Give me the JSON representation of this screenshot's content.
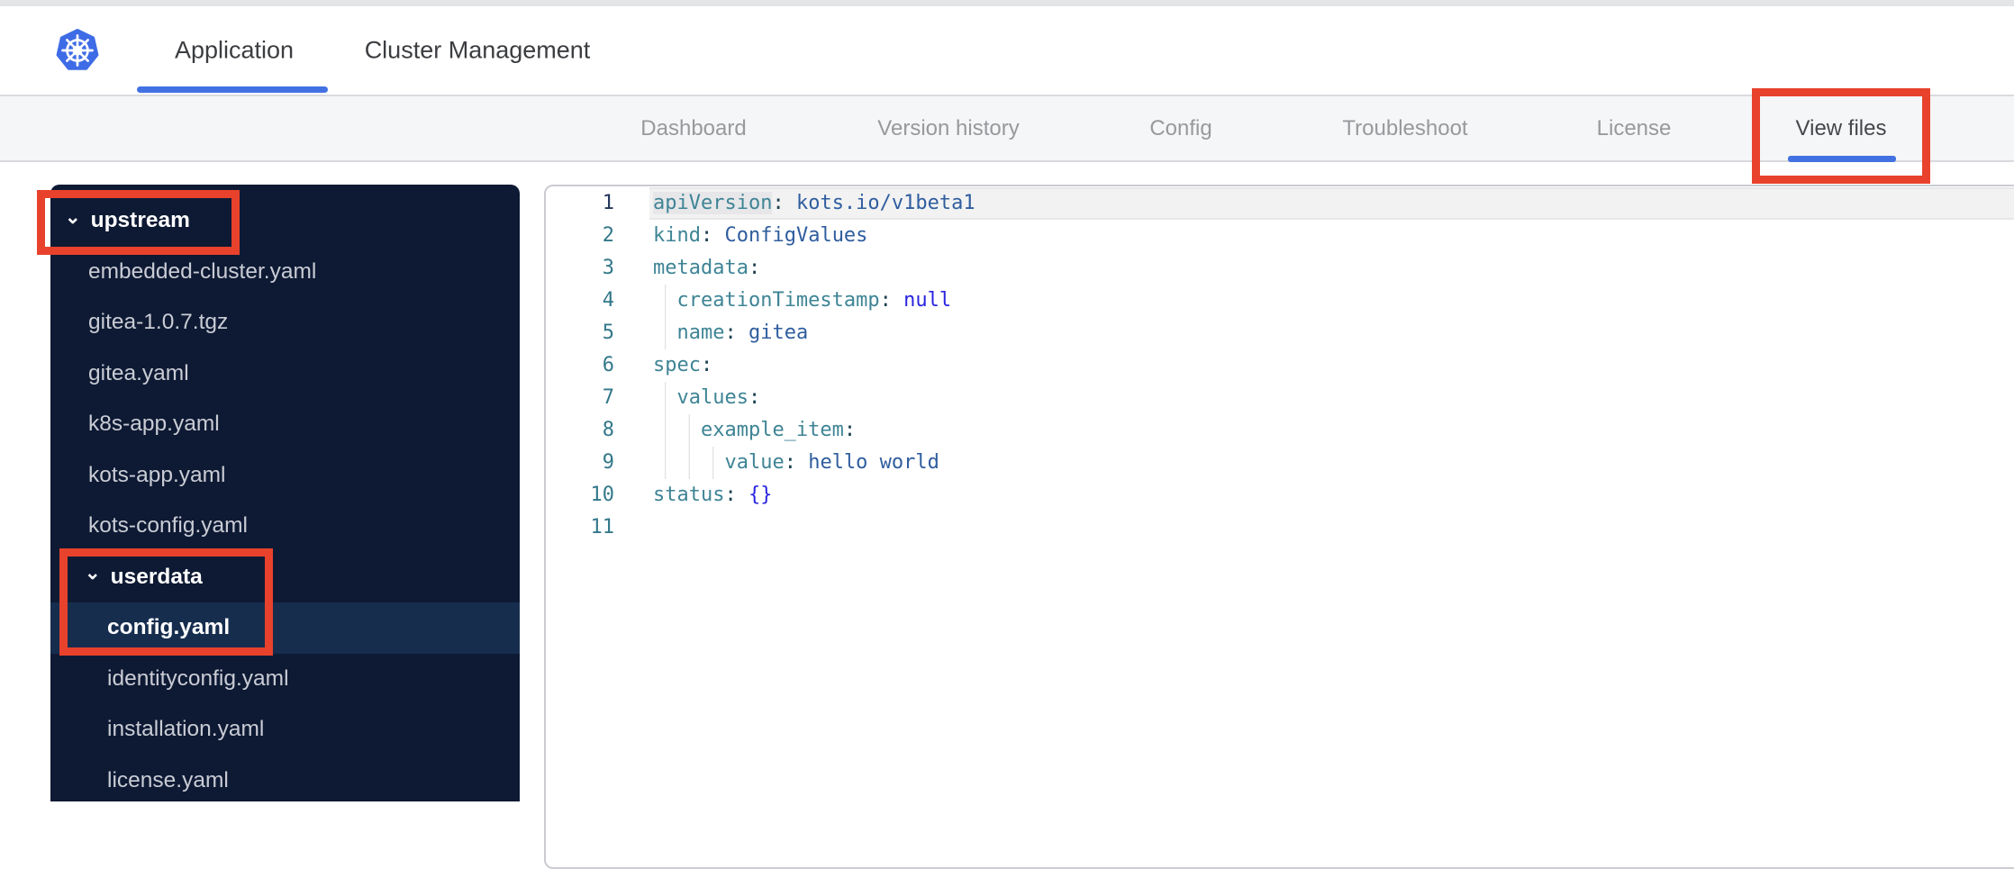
{
  "colors": {
    "accent": "#4271e2",
    "logo-blue": "#3e6ce6",
    "annotation": "#e8422c",
    "sidebar-bg": "#0e1a34",
    "sidebar-selected": "#162d4e",
    "sidebar-file": "#c9ccd4",
    "key": "#3e8495",
    "colon": "#1d4050",
    "value": "#2f5d9e",
    "keyword": "#2a24e0",
    "linenum": "#33788a",
    "nav-inactive": "#97999c",
    "nav-active": "#44474b",
    "header-text": "#3b3d40"
  },
  "header": {
    "logo": "kubernetes-logo",
    "tabs": [
      {
        "label": "Application",
        "active": true
      },
      {
        "label": "Cluster Management",
        "active": false
      }
    ]
  },
  "nav": {
    "items": [
      {
        "label": "Dashboard",
        "active": false
      },
      {
        "label": "Version history",
        "active": false
      },
      {
        "label": "Config",
        "active": false
      },
      {
        "label": "Troubleshoot",
        "active": false
      },
      {
        "label": "License",
        "active": false
      },
      {
        "label": "View files",
        "active": true
      }
    ]
  },
  "file_tree": {
    "chevron": "⌄",
    "items": [
      {
        "label": "upstream",
        "type": "folder",
        "level": 0,
        "expanded": true,
        "annotated": true
      },
      {
        "label": "embedded-cluster.yaml",
        "type": "file",
        "level": 1
      },
      {
        "label": "gitea-1.0.7.tgz",
        "type": "file",
        "level": 1
      },
      {
        "label": "gitea.yaml",
        "type": "file",
        "level": 1
      },
      {
        "label": "k8s-app.yaml",
        "type": "file",
        "level": 1
      },
      {
        "label": "kots-app.yaml",
        "type": "file",
        "level": 1
      },
      {
        "label": "kots-config.yaml",
        "type": "file",
        "level": 1
      },
      {
        "label": "userdata",
        "type": "folder",
        "level": 1,
        "expanded": true,
        "annotated": true
      },
      {
        "label": "config.yaml",
        "type": "file",
        "level": 2,
        "selected": true,
        "annotated": true
      },
      {
        "label": "identityconfig.yaml",
        "type": "file",
        "level": 2
      },
      {
        "label": "installation.yaml",
        "type": "file",
        "level": 2
      },
      {
        "label": "license.yaml",
        "type": "file",
        "level": 2
      }
    ]
  },
  "editor": {
    "lines": [
      {
        "n": 1,
        "current": true,
        "tokens": [
          [
            "key",
            "apiVersion",
            true
          ],
          [
            "colon",
            ": "
          ],
          [
            "str",
            "kots.io/v1beta1"
          ]
        ]
      },
      {
        "n": 2,
        "tokens": [
          [
            "key",
            "kind"
          ],
          [
            "colon",
            ": "
          ],
          [
            "str",
            "ConfigValues"
          ]
        ]
      },
      {
        "n": 3,
        "tokens": [
          [
            "key",
            "metadata"
          ],
          [
            "colon",
            ":"
          ]
        ]
      },
      {
        "n": 4,
        "indent": 2,
        "tokens": [
          [
            "key",
            "creationTimestamp"
          ],
          [
            "colon",
            ": "
          ],
          [
            "kw",
            "null"
          ]
        ]
      },
      {
        "n": 5,
        "indent": 2,
        "tokens": [
          [
            "key",
            "name"
          ],
          [
            "colon",
            ": "
          ],
          [
            "str",
            "gitea"
          ]
        ]
      },
      {
        "n": 6,
        "tokens": [
          [
            "key",
            "spec"
          ],
          [
            "colon",
            ":"
          ]
        ]
      },
      {
        "n": 7,
        "indent": 2,
        "tokens": [
          [
            "key",
            "values"
          ],
          [
            "colon",
            ":"
          ]
        ]
      },
      {
        "n": 8,
        "indent": 4,
        "tokens": [
          [
            "key",
            "example_item"
          ],
          [
            "colon",
            ":"
          ]
        ]
      },
      {
        "n": 9,
        "indent": 6,
        "tokens": [
          [
            "key",
            "value"
          ],
          [
            "colon",
            ": "
          ],
          [
            "str",
            "hello world"
          ]
        ]
      },
      {
        "n": 10,
        "tokens": [
          [
            "key",
            "status"
          ],
          [
            "colon",
            ": "
          ],
          [
            "kw",
            "{}"
          ]
        ]
      },
      {
        "n": 11,
        "tokens": []
      }
    ]
  },
  "annotations": {
    "boxes": [
      "upstream-folder",
      "userdata-folder-and-config-yaml",
      "view-files-tab"
    ]
  }
}
